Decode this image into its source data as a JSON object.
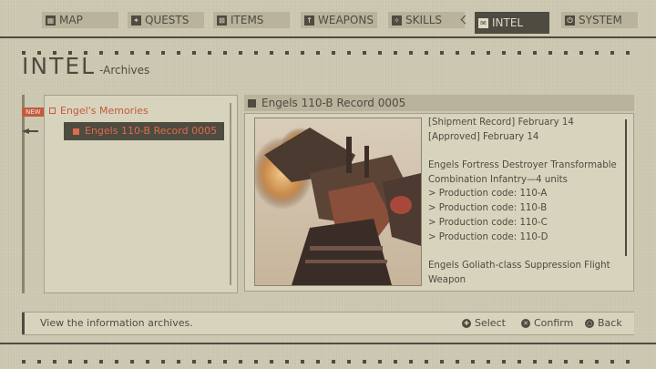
{
  "nav": {
    "tabs": [
      {
        "label": "MAP",
        "icon": "map-icon"
      },
      {
        "label": "QUESTS",
        "icon": "quests-icon"
      },
      {
        "label": "ITEMS",
        "icon": "items-icon"
      },
      {
        "label": "WEAPONS",
        "icon": "weapons-icon"
      },
      {
        "label": "SKILLS",
        "icon": "skills-icon"
      },
      {
        "label": "INTEL",
        "icon": "intel-icon",
        "active": true
      },
      {
        "label": "SYSTEM",
        "icon": "system-icon"
      }
    ]
  },
  "page": {
    "title": "INTEL",
    "subtitle": "-Archives"
  },
  "list": {
    "new_badge": "NEW",
    "category": "Engel's Memories",
    "selected_item": "Engels 110-B Record 0005"
  },
  "detail": {
    "title": "Engels 110-B Record 0005",
    "lines": [
      "[Shipment Record] February 14",
      "[Approved] February 14",
      "",
      "Engels Fortress Destroyer Transformable",
      "Combination Infantry—4 units",
      "> Production code: 110-A",
      "> Production code: 110-B",
      "> Production code: 110-C",
      "> Production code: 110-D",
      "",
      "Engels Goliath-class Suppression Flight",
      "Weapon"
    ]
  },
  "footer": {
    "help_text": "View the information archives.",
    "controls": [
      {
        "label": "Select",
        "icon": "dpad-icon"
      },
      {
        "label": "Confirm",
        "icon": "cross-button-icon"
      },
      {
        "label": "Back",
        "icon": "circle-button-icon"
      }
    ]
  },
  "colors": {
    "background": "#cdc8b1",
    "dark": "#4e4b40",
    "accent": "#c35a3e"
  }
}
